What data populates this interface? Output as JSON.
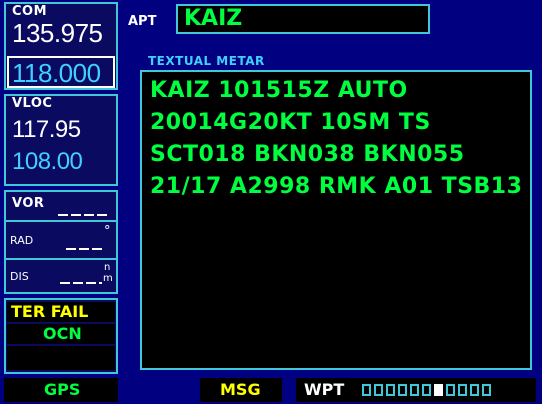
{
  "com": {
    "title": "COM",
    "active": "135.975",
    "standby": "118.000"
  },
  "vloc": {
    "title": "VLOC",
    "active": "117.95",
    "standby": "108.00"
  },
  "vor": {
    "title": "VOR",
    "rad_label": "RAD",
    "dis_label": "DIS",
    "deg_symbol": "°",
    "dis_unit_top": "n",
    "dis_unit_bottom": "m"
  },
  "alerts": {
    "ter_fail": "TER FAIL",
    "ocn": "OCN"
  },
  "apt": {
    "label": "APT",
    "identifier": "KAIZ"
  },
  "metar": {
    "heading": "TEXTUAL METAR",
    "lines": [
      "KAIZ 101515Z AUTO",
      "20014G20KT 10SM TS",
      "SCT018 BKN038 BKN055",
      "21/17 A2998 RMK A01 TSB13"
    ]
  },
  "status_bar": {
    "gps": "GPS",
    "msg": "MSG",
    "page_group": "WPT",
    "page_count": 11,
    "current_page_index": 6
  },
  "colors": {
    "background": "#000080",
    "metar_text": "#00ff40",
    "standby_freq": "#40d0ff",
    "alert": "#ffff00",
    "ocn": "#00ff40",
    "frame": "#40c8d8"
  }
}
